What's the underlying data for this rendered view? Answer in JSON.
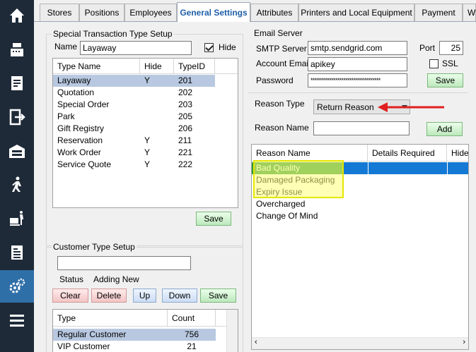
{
  "tabs": [
    "Stores",
    "Positions",
    "Employees",
    "General Settings",
    "Attributes",
    "Printers and Local Equipment",
    "Payment",
    "W"
  ],
  "sidebar": {
    "items": [
      "home-icon",
      "cash-register-icon",
      "receipt-icon",
      "logout-icon",
      "warehouse-icon",
      "walking-person-icon",
      "delivery-cart-icon",
      "report-icon",
      "settings-gear-icon",
      "hamburger-menu-icon"
    ],
    "active_index": 8,
    "colors": {
      "background": "#1e2a38",
      "active": "#2f6fa8"
    }
  },
  "special_transaction": {
    "title": "Special Transaction Type Setup",
    "name_label": "Name",
    "name_value": "Layaway",
    "hide_label": "Hide",
    "hide_checked": true,
    "columns": [
      "Type Name",
      "Hide",
      "TypeID"
    ],
    "rows": [
      {
        "name": "Layaway",
        "hide": "Y",
        "id": "201"
      },
      {
        "name": "Quotation",
        "hide": "",
        "id": "202"
      },
      {
        "name": "Special Order",
        "hide": "",
        "id": "203"
      },
      {
        "name": "Park",
        "hide": "",
        "id": "205"
      },
      {
        "name": "Gift Registry",
        "hide": "",
        "id": "206"
      },
      {
        "name": "Reservation",
        "hide": "Y",
        "id": "211"
      },
      {
        "name": "Work Order",
        "hide": "Y",
        "id": "221"
      },
      {
        "name": "Service Quote",
        "hide": "Y",
        "id": "222"
      }
    ],
    "selected_row": 0,
    "save_label": "Save"
  },
  "customer_type": {
    "title": "Customer Type Setup",
    "input_value": "",
    "status_label": "Status",
    "status_value": "Adding New",
    "buttons": {
      "clear": "Clear",
      "delete": "Delete",
      "up": "Up",
      "down": "Down",
      "save": "Save"
    },
    "columns": [
      "Type",
      "Count"
    ],
    "rows": [
      {
        "type": "Regular Customer",
        "count": "756"
      },
      {
        "type": "VIP Customer",
        "count": "21"
      }
    ],
    "selected_row": 0
  },
  "email_server": {
    "title": "Email Server",
    "smtp_label": "SMTP Server",
    "smtp_value": "smtp.sendgrid.com",
    "port_label": "Port",
    "port_value": "25",
    "account_label": "Account Email",
    "account_value": "apikey",
    "ssl_label": "SSL",
    "ssl_checked": false,
    "password_label": "Password",
    "password_value": "**********************************",
    "save_label": "Save"
  },
  "reason": {
    "type_label": "Reason Type",
    "type_value": "Return Reason",
    "name_label": "Reason Name",
    "name_value": "",
    "add_label": "Add",
    "columns": [
      "Reason Name",
      "Details Required",
      "Hide"
    ],
    "rows": [
      "Bad Quality",
      "Damaged Packaging",
      "Expiry Issue",
      "Overcharged",
      "Change Of Mind"
    ],
    "selected_row": 0,
    "highlighted_rows": [
      0,
      1,
      2
    ]
  },
  "colors": {
    "tab_active_text": "#1d5fa7",
    "selection": "#b8c8e0",
    "selection_blue": "#1479d4",
    "highlight": "#ffff78",
    "annotation_arrow": "#e02020"
  }
}
